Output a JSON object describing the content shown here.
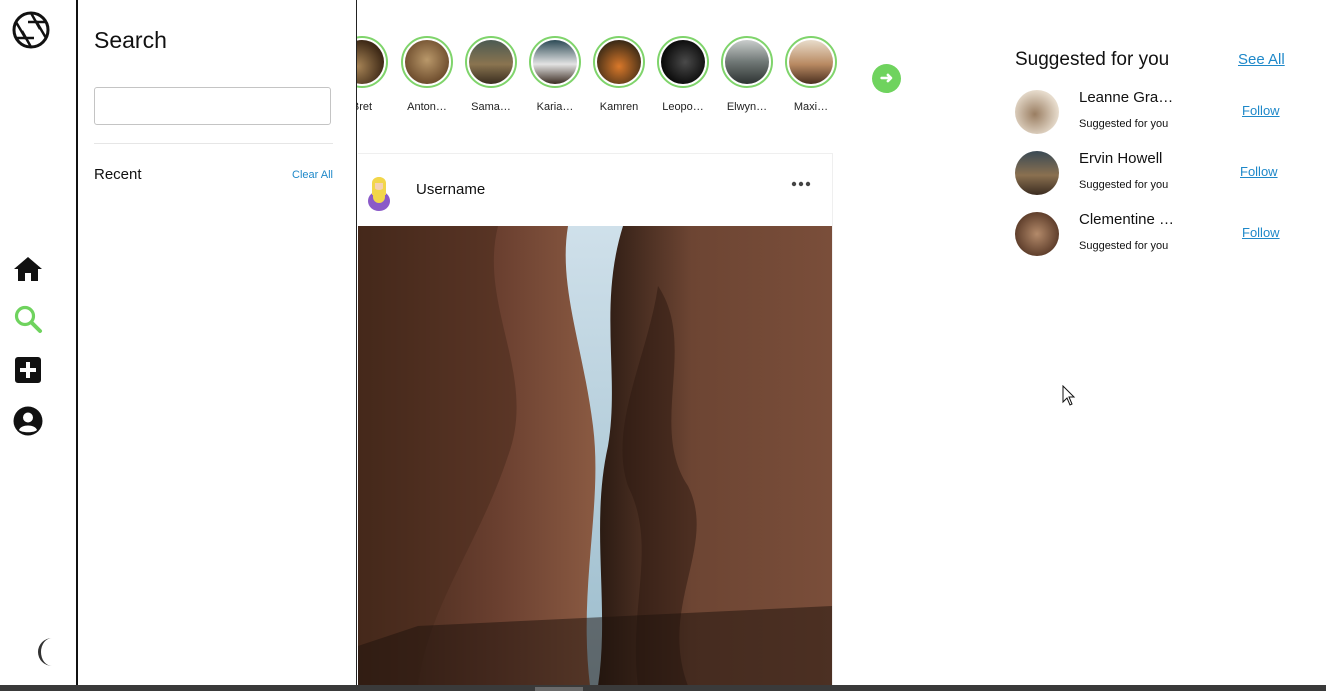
{
  "nav": {
    "logo_icon": "aperture-icon",
    "items": [
      {
        "name": "home",
        "icon": "home-icon"
      },
      {
        "name": "search",
        "icon": "search-icon",
        "active": true
      },
      {
        "name": "create",
        "icon": "plus-square-icon"
      },
      {
        "name": "profile",
        "icon": "user-circle-icon"
      }
    ],
    "theme_icon": "moon-icon",
    "accent_color": "#6fd35e"
  },
  "search_panel": {
    "title": "Search",
    "input_value": "",
    "input_placeholder": "",
    "recent_label": "Recent",
    "clear_all_label": "Clear All"
  },
  "stories": [
    {
      "name": "Bret"
    },
    {
      "name": "Anton…"
    },
    {
      "name": "Sama…"
    },
    {
      "name": "Karia…"
    },
    {
      "name": "Kamren"
    },
    {
      "name": "Leopo…"
    },
    {
      "name": "Elwyn…"
    },
    {
      "name": "Maxi…"
    }
  ],
  "stories_next_icon": "arrow-right-icon",
  "post": {
    "username": "Username",
    "more_icon": "ellipsis-icon"
  },
  "suggestions": {
    "title": "Suggested for you",
    "see_all_label": "See All",
    "items": [
      {
        "name": "Leanne Gra…",
        "subtitle": "Suggested for you",
        "action": "Follow"
      },
      {
        "name": "Ervin Howell",
        "subtitle": "Suggested for you",
        "action": "Follow"
      },
      {
        "name": "Clementine …",
        "subtitle": "Suggested for you",
        "action": "Follow"
      }
    ]
  }
}
